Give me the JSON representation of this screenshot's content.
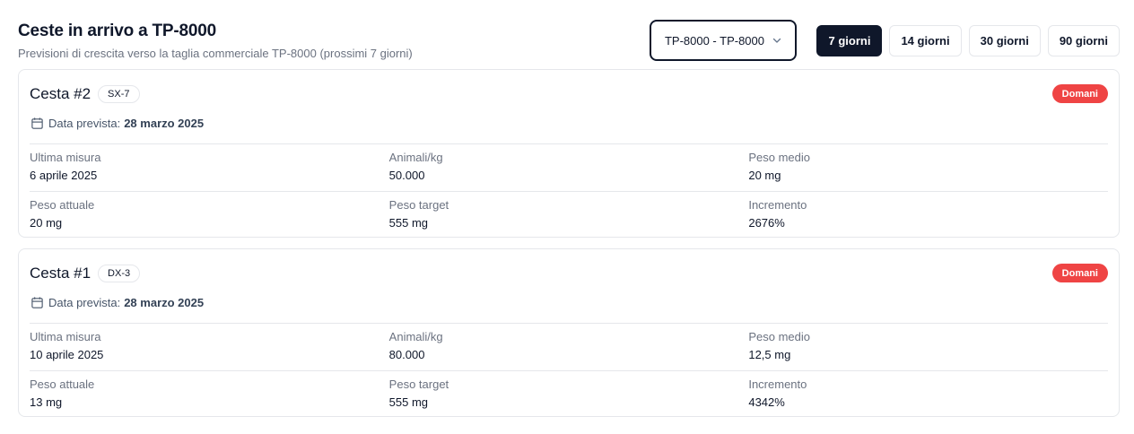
{
  "header": {
    "title": "Ceste in arrivo a TP-8000",
    "subtitle": "Previsioni di crescita verso la taglia commerciale TP-8000 (prossimi 7 giorni)"
  },
  "size_select": {
    "value": "TP-8000 - TP-8000",
    "icon": "chevron-down-icon"
  },
  "periods": [
    {
      "label": "7 giorni",
      "active": true
    },
    {
      "label": "14 giorni",
      "active": false
    },
    {
      "label": "30 giorni",
      "active": false
    },
    {
      "label": "90 giorni",
      "active": false
    }
  ],
  "baskets": [
    {
      "title": "Cesta #2",
      "tag": "SX-7",
      "badge": "Domani",
      "date_label": "Data prevista:",
      "date_value": "28 marzo 2025",
      "rows": [
        [
          {
            "label": "Ultima misura",
            "value": "6 aprile 2025"
          },
          {
            "label": "Animali/kg",
            "value": "50.000"
          },
          {
            "label": "Peso medio",
            "value": "20 mg"
          }
        ],
        [
          {
            "label": "Peso attuale",
            "value": "20 mg"
          },
          {
            "label": "Peso target",
            "value": "555 mg"
          },
          {
            "label": "Incremento",
            "value": "2676%"
          }
        ]
      ]
    },
    {
      "title": "Cesta #1",
      "tag": "DX-3",
      "badge": "Domani",
      "date_label": "Data prevista:",
      "date_value": "28 marzo 2025",
      "rows": [
        [
          {
            "label": "Ultima misura",
            "value": "10 aprile 2025"
          },
          {
            "label": "Animali/kg",
            "value": "80.000"
          },
          {
            "label": "Peso medio",
            "value": "12,5 mg"
          }
        ],
        [
          {
            "label": "Peso attuale",
            "value": "13 mg"
          },
          {
            "label": "Peso target",
            "value": "555 mg"
          },
          {
            "label": "Incremento",
            "value": "4342%"
          }
        ]
      ]
    }
  ],
  "colors": {
    "primary": "#0f172a",
    "badge": "#ef4444",
    "border": "#e5e7eb",
    "muted": "#6b7280"
  }
}
